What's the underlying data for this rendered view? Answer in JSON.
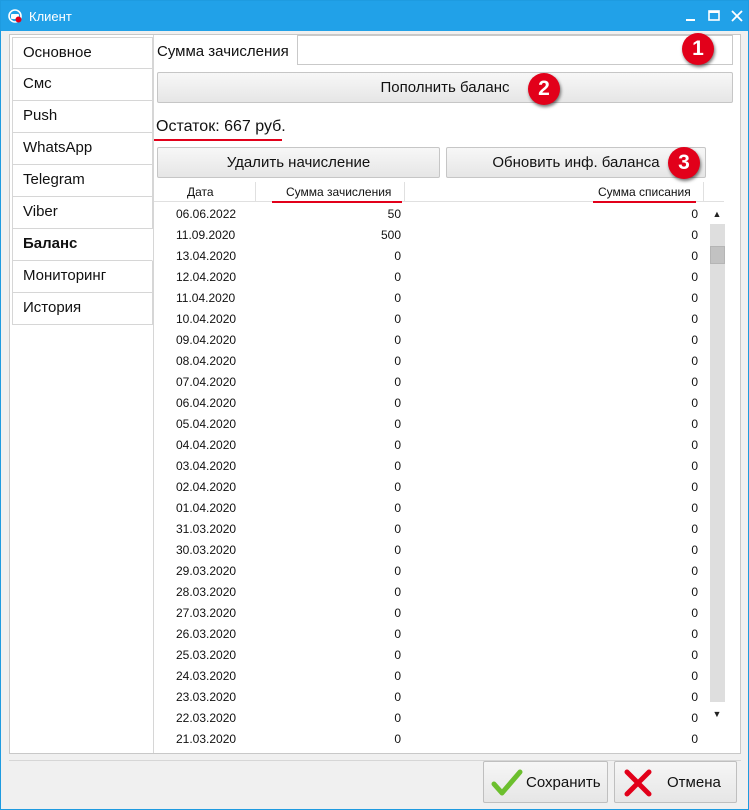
{
  "window": {
    "title": "Клиент",
    "accent": "#21a1e8"
  },
  "sidebar": {
    "items": [
      {
        "label": "Основное"
      },
      {
        "label": "Смс"
      },
      {
        "label": "Push"
      },
      {
        "label": "WhatsApp"
      },
      {
        "label": "Telegram"
      },
      {
        "label": "Viber"
      },
      {
        "label": "Баланс"
      },
      {
        "label": "Мониторинг"
      },
      {
        "label": "История"
      }
    ],
    "active_index": 6
  },
  "balance_panel": {
    "sum_label": "Сумма зачисления",
    "sum_value": "",
    "topup_button": "Пополнить баланс",
    "balance_text": "Остаток: 667 руб.",
    "delete_button": "Удалить начисление",
    "refresh_button": "Обновить инф. баланса",
    "markers": [
      "1",
      "2",
      "3"
    ],
    "marker_color": "#e2001a"
  },
  "table": {
    "columns": [
      "Дата",
      "Сумма зачисления",
      "Сумма списания"
    ],
    "rows": [
      [
        "06.06.2022",
        "50",
        "0"
      ],
      [
        "11.09.2020",
        "500",
        "0"
      ],
      [
        "13.04.2020",
        "0",
        "0"
      ],
      [
        "12.04.2020",
        "0",
        "0"
      ],
      [
        "11.04.2020",
        "0",
        "0"
      ],
      [
        "10.04.2020",
        "0",
        "0"
      ],
      [
        "09.04.2020",
        "0",
        "0"
      ],
      [
        "08.04.2020",
        "0",
        "0"
      ],
      [
        "07.04.2020",
        "0",
        "0"
      ],
      [
        "06.04.2020",
        "0",
        "0"
      ],
      [
        "05.04.2020",
        "0",
        "0"
      ],
      [
        "04.04.2020",
        "0",
        "0"
      ],
      [
        "03.04.2020",
        "0",
        "0"
      ],
      [
        "02.04.2020",
        "0",
        "0"
      ],
      [
        "01.04.2020",
        "0",
        "0"
      ],
      [
        "31.03.2020",
        "0",
        "0"
      ],
      [
        "30.03.2020",
        "0",
        "0"
      ],
      [
        "29.03.2020",
        "0",
        "0"
      ],
      [
        "28.03.2020",
        "0",
        "0"
      ],
      [
        "27.03.2020",
        "0",
        "0"
      ],
      [
        "26.03.2020",
        "0",
        "0"
      ],
      [
        "25.03.2020",
        "0",
        "0"
      ],
      [
        "24.03.2020",
        "0",
        "0"
      ],
      [
        "23.03.2020",
        "0",
        "0"
      ],
      [
        "22.03.2020",
        "0",
        "0"
      ],
      [
        "21.03.2020",
        "0",
        "0"
      ]
    ]
  },
  "footer": {
    "save_button": "Сохранить",
    "cancel_button": "Отмена",
    "save_icon": "check-icon",
    "cancel_icon": "cross-icon"
  }
}
